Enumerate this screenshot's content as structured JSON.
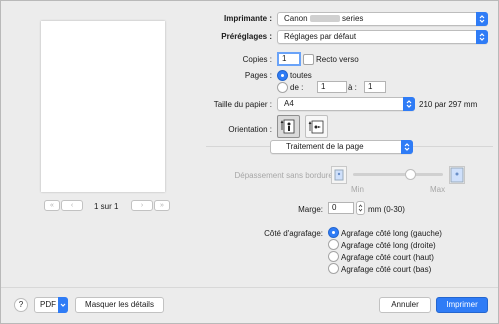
{
  "printer": {
    "label": "Imprimante :",
    "value_prefix": "Canon",
    "value_suffix": "series"
  },
  "presets": {
    "label": "Préréglages :",
    "value": "Réglages par défaut"
  },
  "copies": {
    "label": "Copies :",
    "value": "1",
    "duplex_label": "Recto verso"
  },
  "pages": {
    "label": "Pages :",
    "all_label": "toutes",
    "from_label": "de :",
    "from_value": "1",
    "to_label": "à :",
    "to_value": "1"
  },
  "paper_size": {
    "label": "Taille du papier :",
    "value": "A4",
    "dimensions": "210 par 297 mm"
  },
  "orientation": {
    "label": "Orientation :"
  },
  "section": {
    "value": "Traitement de la page"
  },
  "borderless": {
    "label": "Dépassement sans bordure:",
    "min_label": "Min",
    "max_label": "Max"
  },
  "margin": {
    "label": "Marge:",
    "value": "0",
    "unit": "mm (0-30)"
  },
  "stapling": {
    "label": "Côté d'agrafage:",
    "options": [
      "Agrafage côté long (gauche)",
      "Agrafage côté long (droite)",
      "Agrafage côté court (haut)",
      "Agrafage côté court (bas)"
    ]
  },
  "preview": {
    "page_indicator": "1 sur 1"
  },
  "footer": {
    "help": "?",
    "pdf_label": "PDF",
    "hide_details": "Masquer les détails",
    "cancel": "Annuler",
    "print": "Imprimer"
  },
  "colors": {
    "accent": "#2f7cf6",
    "background": "#ececec"
  }
}
